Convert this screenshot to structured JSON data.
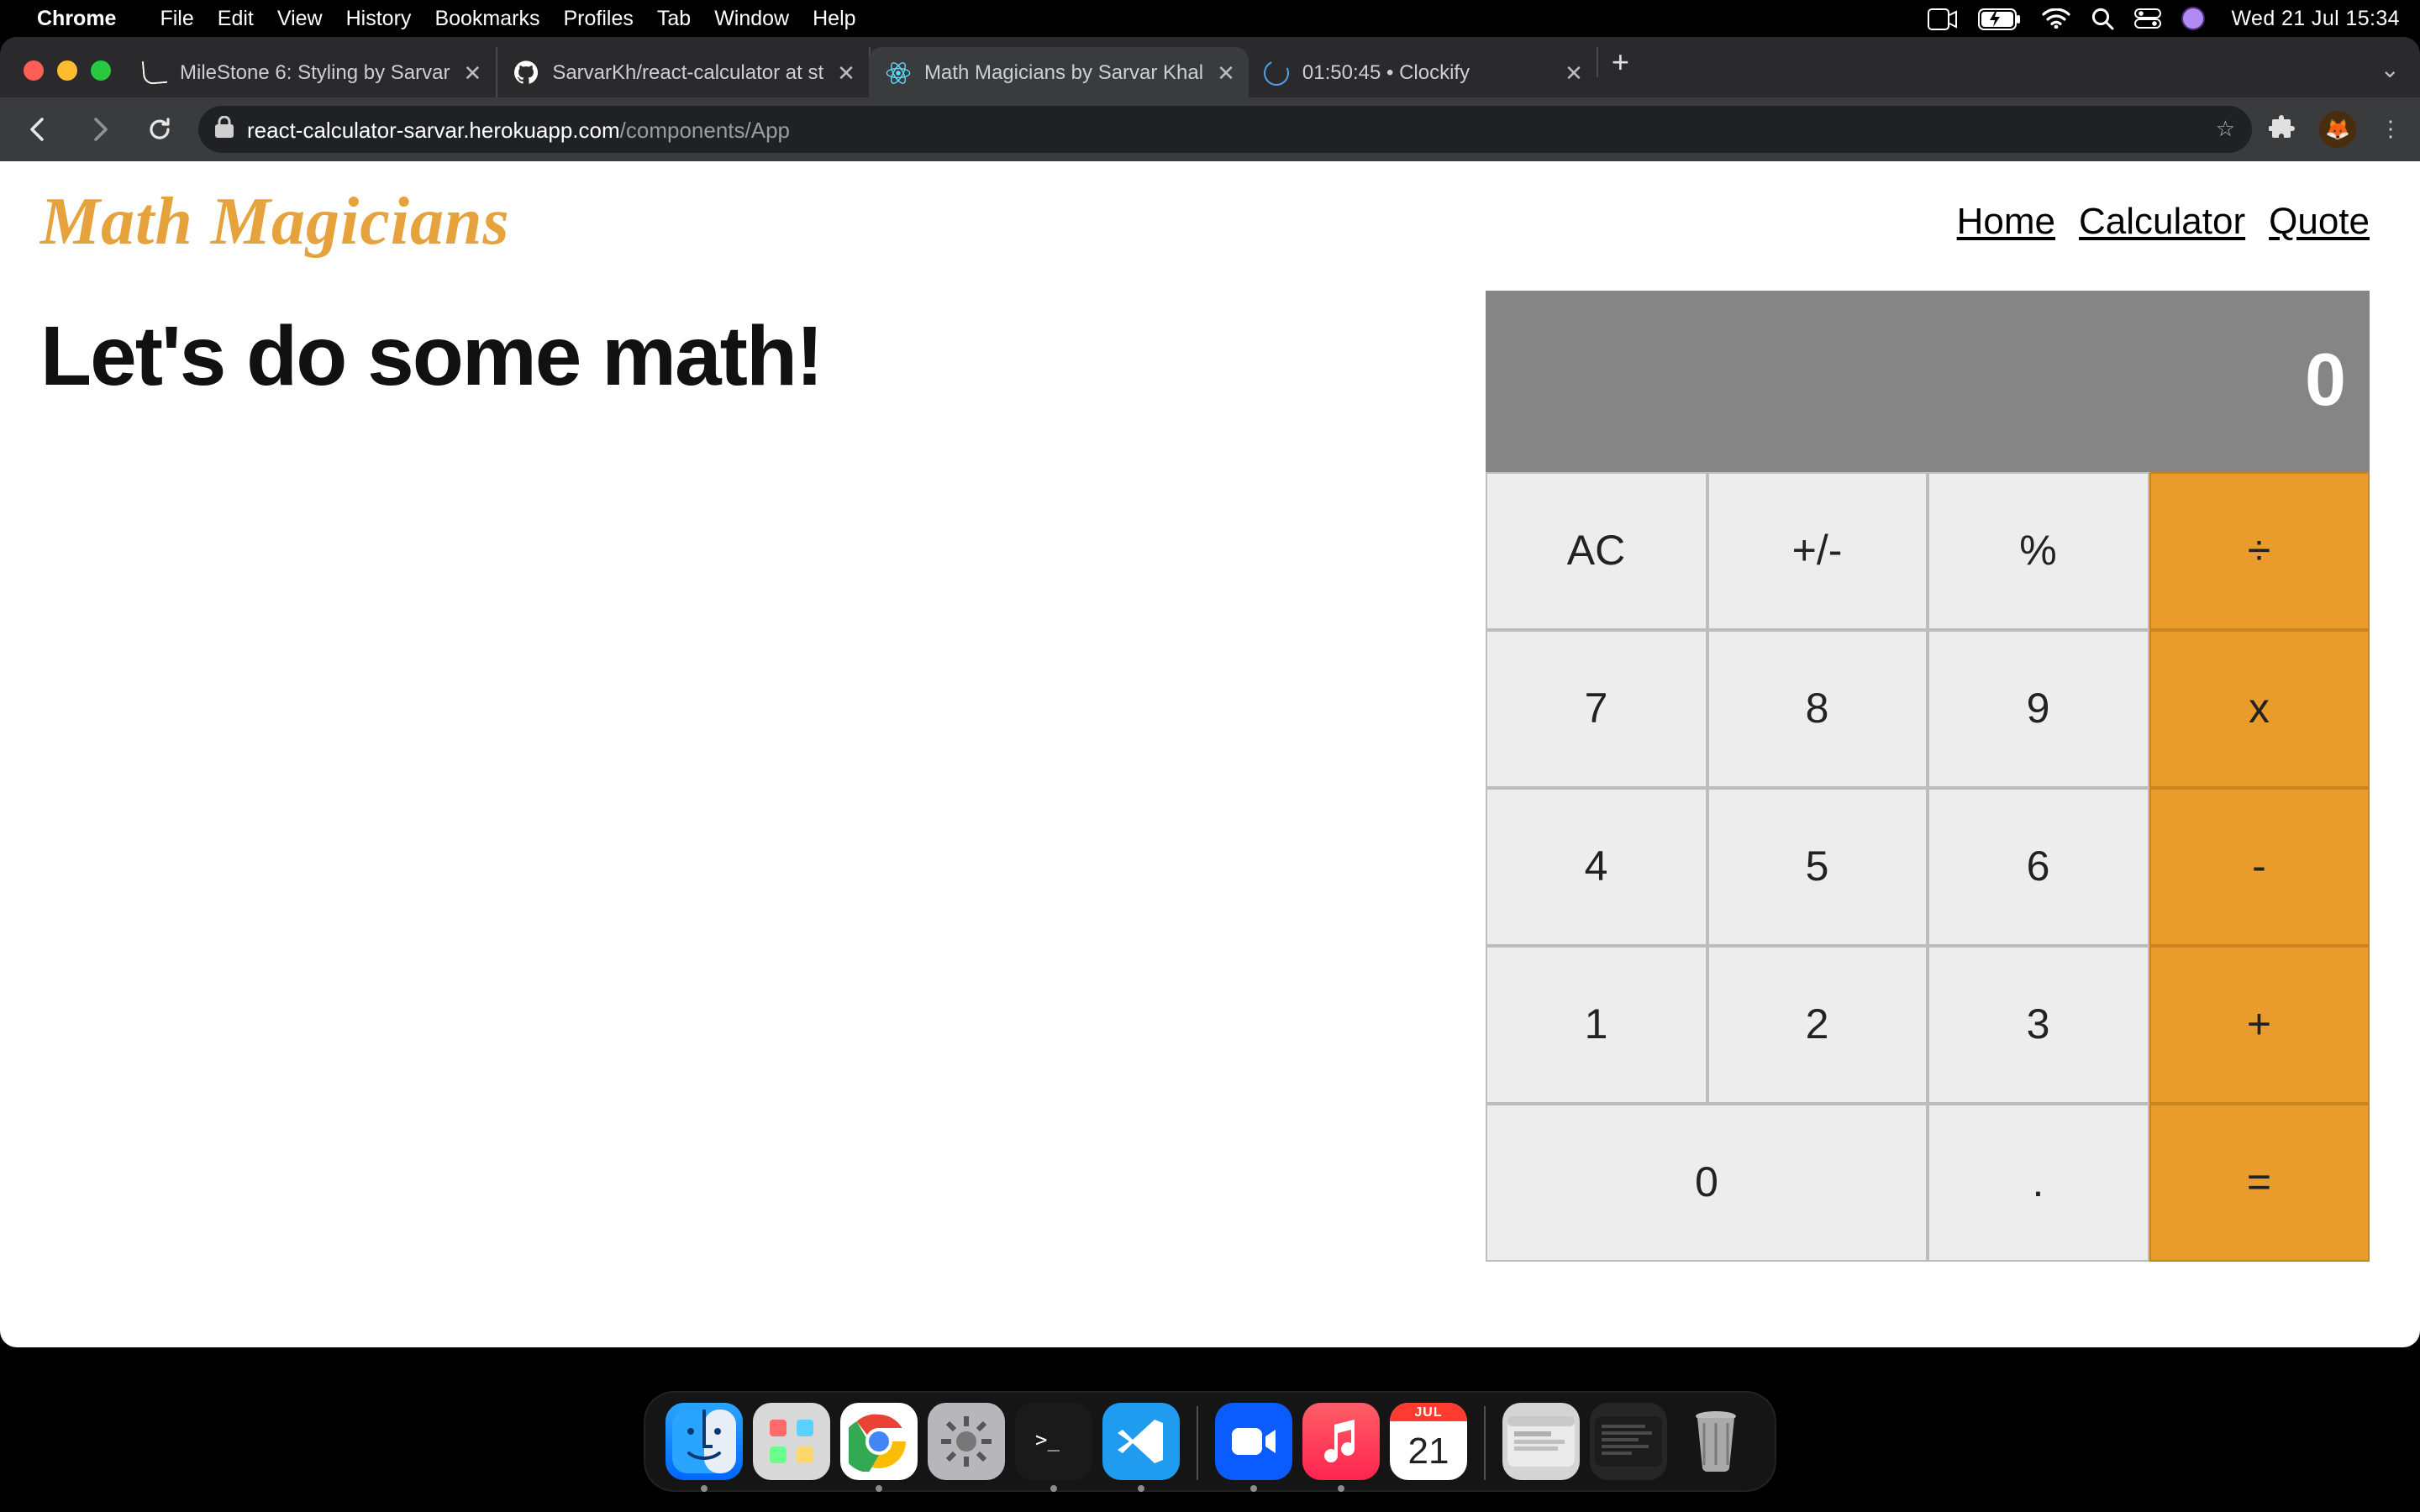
{
  "menubar": {
    "app_name": "Chrome",
    "items": [
      "File",
      "Edit",
      "View",
      "History",
      "Bookmarks",
      "Profiles",
      "Tab",
      "Window",
      "Help"
    ],
    "clock": "Wed 21 Jul  15:34"
  },
  "browser": {
    "tabs": [
      {
        "title": "MileStone 6: Styling by Sarvar",
        "favicon": "microverse"
      },
      {
        "title": "SarvarKh/react-calculator at st",
        "favicon": "github"
      },
      {
        "title": "Math Magicians by Sarvar Khal",
        "favicon": "react",
        "active": true
      },
      {
        "title": "01:50:45 • Clockify",
        "favicon": "clockify"
      }
    ],
    "url_host": "react-calculator-sarvar.herokuapp.com",
    "url_path": "/components/App"
  },
  "page": {
    "brand": "Math Magicians",
    "nav": {
      "home": "Home",
      "calculator": "Calculator",
      "quote": "Quote"
    },
    "heading": "Let's do some math!"
  },
  "calc": {
    "display": "0",
    "keys": [
      "AC",
      "+/-",
      "%",
      "÷",
      "7",
      "8",
      "9",
      "x",
      "4",
      "5",
      "6",
      "-",
      "1",
      "2",
      "3",
      "+",
      "0",
      ".",
      "="
    ]
  },
  "dock": {
    "calendar_month": "JUL",
    "calendar_day": "21"
  }
}
